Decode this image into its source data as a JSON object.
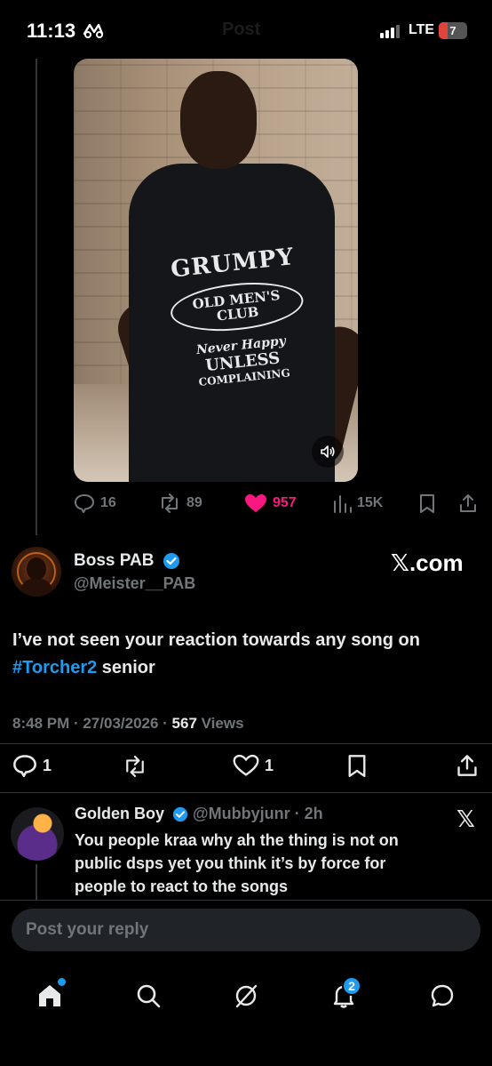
{
  "status_bar": {
    "time": "11:13",
    "network": "LTE",
    "battery": "7",
    "faded_title": "Post"
  },
  "video": {
    "shirt_lines": [
      "GRUMPY",
      "OLD MEN'S CLUB",
      "Never Happy",
      "UNLESS",
      "COMPLAINING"
    ],
    "sound_icon": "speaker-icon"
  },
  "video_actions": {
    "replies": "16",
    "reposts": "89",
    "likes": "957",
    "views": "15K"
  },
  "post": {
    "author_name": "Boss PAB",
    "author_handle": "@Meister__PAB",
    "brand": "𝕏.com",
    "text_before": "I’ve not seen your reaction towards any song on ",
    "hashtag": "#Torcher2",
    "text_after": " senior",
    "timestamp": "8:48 PM · 27/03/2026 · ",
    "views_count": "567",
    "views_label": " Views",
    "replies": "1",
    "likes": "1"
  },
  "reply": {
    "author_name": "Golden Boy",
    "author_handle": "@Mubbyjunr",
    "time": " · 2h",
    "text": "You people kraa why ah the thing is not on public dsps yet you think it’s by force for people to react to the songs"
  },
  "composer": {
    "placeholder": "Post your reply"
  },
  "tabbar": {
    "notifications_badge": "2"
  },
  "colors": {
    "accent": "#1d9bf0",
    "like": "#f91880",
    "muted": "#71767b",
    "background": "#000000"
  }
}
